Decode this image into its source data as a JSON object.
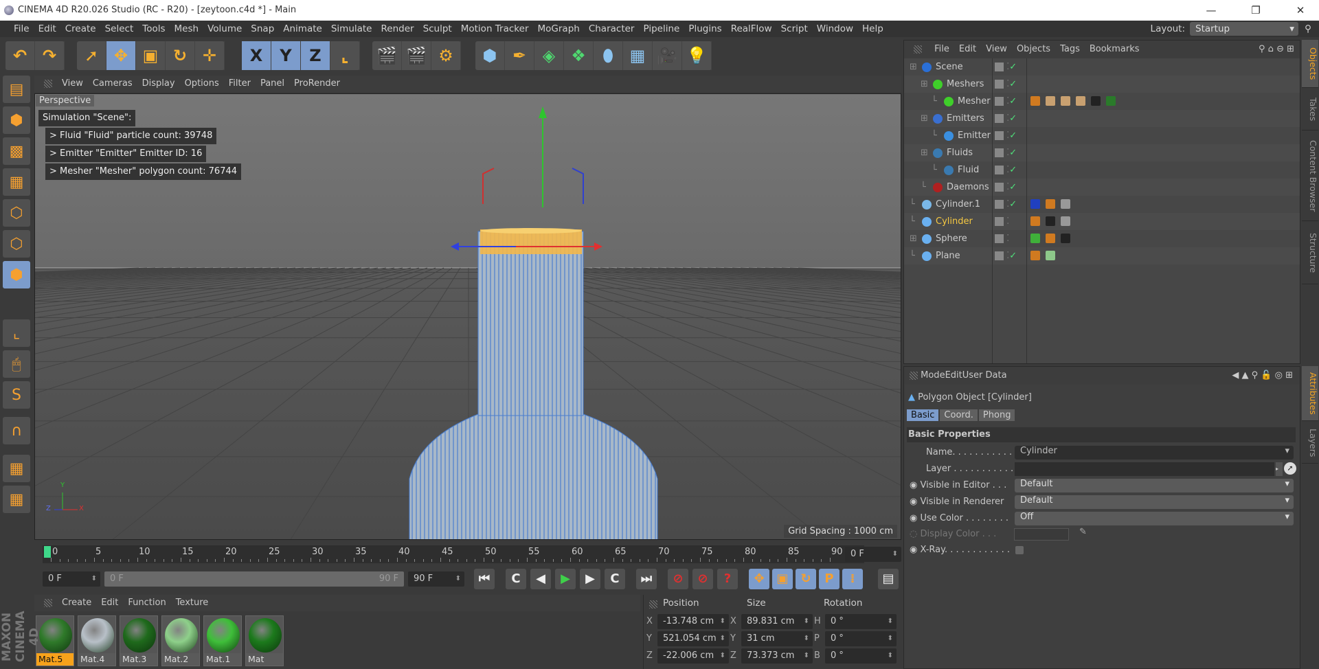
{
  "window": {
    "title": "CINEMA 4D R20.026 Studio (RC - R20) - [zeytoon.c4d *] - Main",
    "minimize": "—",
    "maximize": "❐",
    "close": "✕"
  },
  "menubar": {
    "items": [
      "File",
      "Edit",
      "Create",
      "Select",
      "Tools",
      "Mesh",
      "Volume",
      "Snap",
      "Animate",
      "Simulate",
      "Render",
      "Sculpt",
      "Motion Tracker",
      "MoGraph",
      "Character",
      "Pipeline",
      "Plugins",
      "RealFlow",
      "Script",
      "Window",
      "Help"
    ],
    "layout_label": "Layout:",
    "layout_value": "Startup"
  },
  "toolbar": {
    "groups": [
      [
        {
          "icon": "undo-icon",
          "g": "↶"
        },
        {
          "icon": "redo-icon",
          "g": "↷"
        }
      ],
      [
        {
          "icon": "live-selection-icon",
          "g": "➚"
        },
        {
          "icon": "move-icon",
          "g": "✥",
          "on": true
        },
        {
          "icon": "scale-icon",
          "g": "▣"
        },
        {
          "icon": "rotate-icon",
          "g": "↻"
        },
        {
          "icon": "recent-tool-icon",
          "g": "✛"
        }
      ],
      [
        {
          "icon": "x-axis-icon",
          "g": "X",
          "on": true
        },
        {
          "icon": "y-axis-icon",
          "g": "Y",
          "on": true
        },
        {
          "icon": "z-axis-icon",
          "g": "Z",
          "on": true
        },
        {
          "icon": "coordinate-system-icon",
          "g": "⌞"
        }
      ],
      [
        {
          "icon": "render-view-icon",
          "g": "🎬"
        },
        {
          "icon": "render-picture-viewer-icon",
          "g": "🎬"
        },
        {
          "icon": "render-settings-icon",
          "g": "⚙"
        }
      ],
      [
        {
          "icon": "cube-icon",
          "g": "⬢"
        },
        {
          "icon": "pen-icon",
          "g": "✒"
        },
        {
          "icon": "subdivision-icon",
          "g": "◈"
        },
        {
          "icon": "array-icon",
          "g": "❖"
        },
        {
          "icon": "deformer-icon",
          "g": "⬮"
        },
        {
          "icon": "floor-icon",
          "g": "▦"
        },
        {
          "icon": "camera-icon",
          "g": "🎥"
        },
        {
          "icon": "light-icon",
          "g": "💡"
        }
      ]
    ]
  },
  "lefttools": [
    {
      "icon": "make-editable-icon",
      "g": "▤"
    },
    {
      "icon": "model-mode-icon",
      "g": "⬢"
    },
    {
      "icon": "texture-mode-icon",
      "g": "▩"
    },
    {
      "icon": "workplane-icon",
      "g": "▦"
    },
    {
      "icon": "points-mode-icon",
      "g": "⬡"
    },
    {
      "icon": "edges-mode-icon",
      "g": "⬡"
    },
    {
      "icon": "polygons-mode-icon",
      "g": "⬢",
      "on": true
    },
    {
      "icon": "axis-mode-icon",
      "g": "⌞"
    },
    {
      "icon": "tweak-mode-icon",
      "g": "🖱"
    },
    {
      "icon": "snap-icon",
      "g": "S"
    },
    {
      "icon": "magnet-icon",
      "g": "∩"
    },
    {
      "icon": "lock-workplane-icon",
      "g": "▦"
    },
    {
      "icon": "planar-workplane-icon",
      "g": "▦"
    }
  ],
  "viewport": {
    "menu": [
      "View",
      "Cameras",
      "Display",
      "Options",
      "Filter",
      "Panel",
      "ProRender"
    ],
    "label": "Perspective",
    "hud": [
      "Simulation \"Scene\":",
      "> Fluid \"Fluid\" particle count: 39748",
      "> Emitter \"Emitter\" Emitter ID: 16",
      "> Mesher \"Mesher\" polygon count: 76744"
    ],
    "grid_spacing": "Grid Spacing : 1000 cm",
    "axis": {
      "x": "X",
      "y": "Y",
      "z": "Z"
    }
  },
  "timeline": {
    "ticks": [
      "0",
      "5",
      "10",
      "15",
      "20",
      "25",
      "30",
      "35",
      "40",
      "45",
      "50",
      "55",
      "60",
      "65",
      "70",
      "75",
      "80",
      "85",
      "90"
    ],
    "current": "0 F",
    "start": "0 F",
    "range_start": "0 F",
    "range_end": "90 F",
    "end": "90 F",
    "transport": [
      {
        "icon": "go-to-start-icon",
        "g": "⏮"
      },
      {
        "icon": "previous-key-icon",
        "g": "C"
      },
      {
        "icon": "previous-frame-icon",
        "g": "◀"
      },
      {
        "icon": "play-icon",
        "g": "▶"
      },
      {
        "icon": "next-frame-icon",
        "g": "▶"
      },
      {
        "icon": "next-key-icon",
        "g": "C"
      },
      {
        "icon": "go-to-end-icon",
        "g": "⏭"
      },
      {
        "icon": "record-icon",
        "g": "⊘"
      },
      {
        "icon": "autokey-icon",
        "g": "⊘"
      },
      {
        "icon": "keyframe-selection-icon",
        "g": "?"
      },
      {
        "icon": "key-position-icon",
        "g": "✥"
      },
      {
        "icon": "key-scale-icon",
        "g": "▣"
      },
      {
        "icon": "key-rotation-icon",
        "g": "↻"
      },
      {
        "icon": "key-parameter-icon",
        "g": "P"
      },
      {
        "icon": "key-pla-icon",
        "g": "⁞"
      },
      {
        "icon": "timeline-icon",
        "g": "▤"
      }
    ]
  },
  "materials": {
    "menu": [
      "Create",
      "Edit",
      "Function",
      "Texture"
    ],
    "items": [
      {
        "name": "Mat.5",
        "color": "#2f7a2a",
        "sel": true
      },
      {
        "name": "Mat.4",
        "color": "#b8c0c8"
      },
      {
        "name": "Mat.3",
        "color": "#1f6a1c"
      },
      {
        "name": "Mat.2",
        "color": "#8ed08a"
      },
      {
        "name": "Mat.1",
        "color": "#3fbf3a"
      },
      {
        "name": "Mat",
        "color": "#1c7a1c"
      }
    ],
    "brand": "MAXON CINEMA 4D"
  },
  "coords": {
    "headers": [
      "Position",
      "Size",
      "Rotation"
    ],
    "rows": [
      {
        "pl": "X",
        "p": "-13.748 cm",
        "sl": "X",
        "s": "89.831 cm",
        "rl": "H",
        "r": "0 °"
      },
      {
        "pl": "Y",
        "p": "521.054 cm",
        "sl": "Y",
        "s": "31 cm",
        "rl": "P",
        "r": "0 °"
      },
      {
        "pl": "Z",
        "p": "-22.006 cm",
        "sl": "Z",
        "s": "73.373 cm",
        "rl": "B",
        "r": "0 °"
      }
    ]
  },
  "objects": {
    "menu": [
      "File",
      "Edit",
      "View",
      "Objects",
      "Tags",
      "Bookmarks"
    ],
    "items": [
      {
        "name": "Scene",
        "depth": 0,
        "icon": "#2a6fd6",
        "check": true,
        "tags": []
      },
      {
        "name": "Meshers",
        "depth": 1,
        "icon": "#3fcf2a",
        "check": true,
        "tags": []
      },
      {
        "name": "Mesher",
        "depth": 2,
        "icon": "#3fcf2a",
        "check": true,
        "tags": [
          "#d07a20",
          "#c8a070",
          "#c8a070",
          "#c8a070",
          "#222",
          "#2a7a2a"
        ]
      },
      {
        "name": "Emitters",
        "depth": 1,
        "icon": "#3a6fd0",
        "check": true,
        "tags": []
      },
      {
        "name": "Emitter",
        "depth": 2,
        "icon": "#3a8fe0",
        "check": true,
        "tags": []
      },
      {
        "name": "Fluids",
        "depth": 1,
        "icon": "#3a7ab0",
        "check": true,
        "tags": []
      },
      {
        "name": "Fluid",
        "depth": 2,
        "icon": "#3a7ab0",
        "check": true,
        "tags": []
      },
      {
        "name": "Daemons",
        "depth": 1,
        "icon": "#b02020",
        "check": true,
        "tags": []
      },
      {
        "name": "Cylinder.1",
        "depth": 0,
        "icon": "#7ab8e8",
        "check": true,
        "tags": [
          "#2040c0",
          "#d07a20",
          "#999"
        ]
      },
      {
        "name": "Cylinder",
        "depth": 0,
        "icon": "#6ab0f0",
        "check": false,
        "sel": true,
        "tags": [
          "#d07a20",
          "#222",
          "#999"
        ]
      },
      {
        "name": "Sphere",
        "depth": 0,
        "icon": "#6ab0f0",
        "check": false,
        "tags": [
          "#3fb03a",
          "#d07a20",
          "#222"
        ]
      },
      {
        "name": "Plane",
        "depth": 0,
        "icon": "#6ab0f0",
        "check": true,
        "tags": [
          "#d07a20",
          "#8ec88a"
        ]
      }
    ]
  },
  "attributes": {
    "menu": [
      "Mode",
      "Edit",
      "User Data"
    ],
    "object_title": "Polygon Object [Cylinder]",
    "tabs": [
      "Basic",
      "Coord.",
      "Phong"
    ],
    "section": "Basic Properties",
    "fields": {
      "name_label": "Name. . . . . . . . . . . .",
      "name_value": "Cylinder",
      "layer_label": "Layer . . . . . . . . . . . .",
      "vis_editor_label": "Visible in Editor . . .",
      "vis_editor_value": "Default",
      "vis_render_label": "Visible in Renderer",
      "vis_render_value": "Default",
      "use_color_label": "Use Color . . . . . . . .",
      "use_color_value": "Off",
      "display_color_label": "Display Color . . .",
      "xray_label": "X-Ray. . . . . . . . . . . ."
    }
  },
  "side_tabs": {
    "top": [
      "Objects",
      "Takes",
      "Content Browser",
      "Structure"
    ],
    "bottom": [
      "Attributes",
      "Layers"
    ]
  },
  "colors": {
    "accent": "#7c9ccc",
    "highlight": "#f7a21b",
    "selected_object": "#f5c842"
  }
}
